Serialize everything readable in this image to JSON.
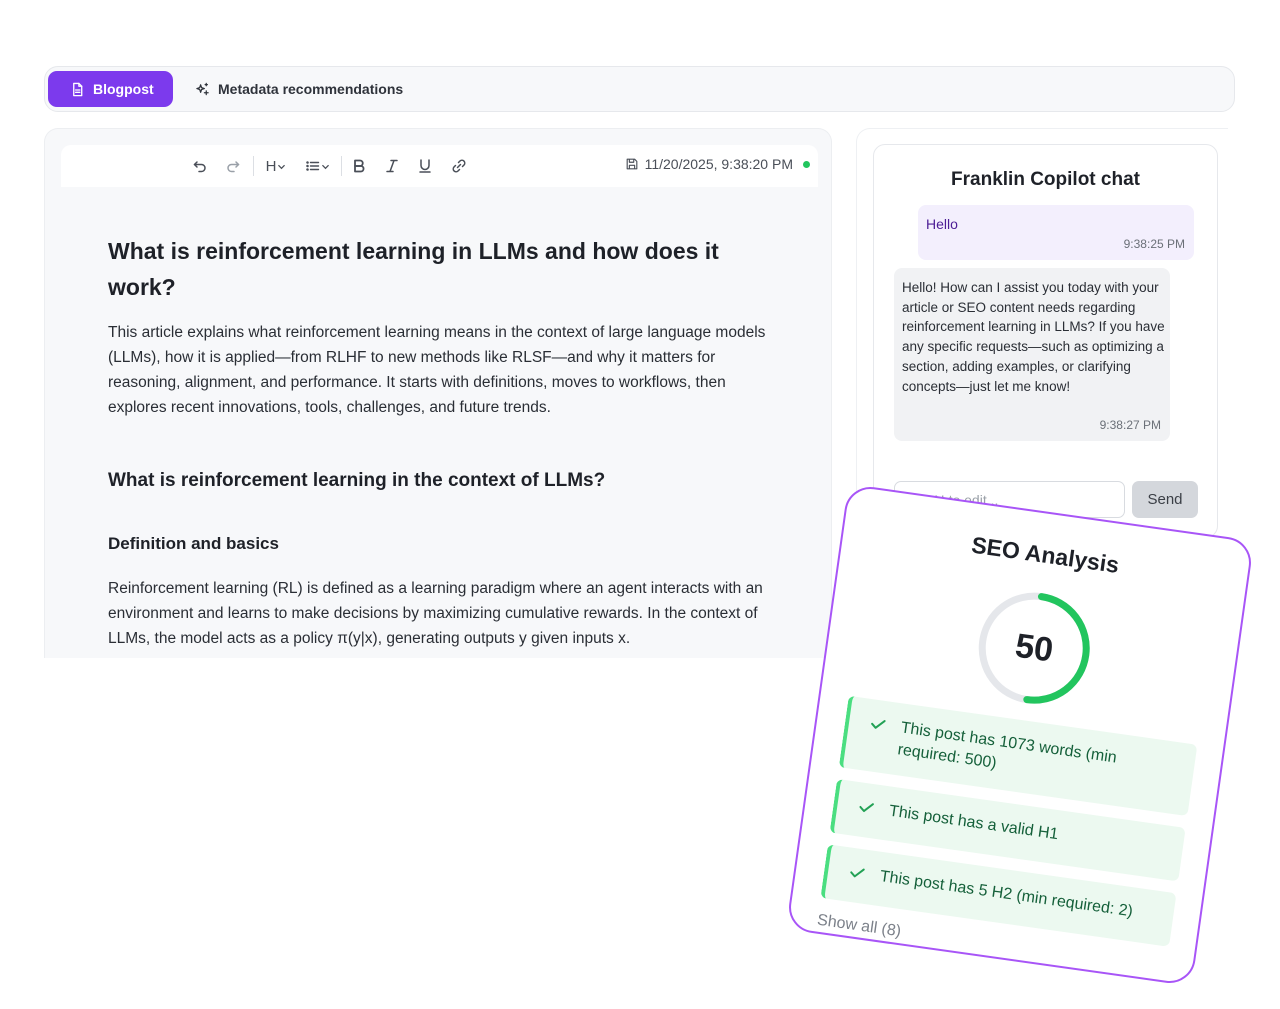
{
  "tabs": [
    {
      "label": "Blogpost",
      "icon": "document-icon",
      "active": true
    },
    {
      "label": "Metadata recommendations",
      "icon": "sparkles-icon",
      "active": false
    }
  ],
  "toolbar": {
    "heading_label": "H",
    "timestamp": "11/20/2025, 9:38:20 PM",
    "status_color": "#22c55e"
  },
  "document": {
    "title": "What is reinforcement learning in LLMs and how does it work?",
    "intro": "This article explains what reinforcement learning means in the context of large language models (LLMs), how it is applied—from RLHF to new methods like RLSF—and why it matters for reasoning, alignment, and performance. It starts with definitions, moves to workflows, then explores recent innovations, tools, challenges, and future trends.",
    "h2": "What is reinforcement learning in the context of LLMs?",
    "h3": "Definition and basics",
    "body": "Reinforcement learning (RL) is defined as a learning paradigm where an agent interacts with an environment and learns to make decisions by maximizing cumulative rewards. In the context of LLMs, the model acts as a policy π(y|x), generating outputs y given inputs x."
  },
  "chat": {
    "title": "Franklin Copilot chat",
    "messages": [
      {
        "role": "user",
        "text": "Hello",
        "time": "9:38:25 PM"
      },
      {
        "role": "assistant",
        "text": "Hello! How can I assist you today with your article or SEO content needs regarding reinforcement learning in LLMs? If you have any specific requests—such as optimizing a section, adding examples, or clarifying concepts—just let me know!",
        "time": "9:38:27 PM"
      }
    ],
    "input_placeholder": "Ask AI to edit...",
    "send_label": "Send"
  },
  "seo": {
    "title": "SEO Analysis",
    "score": "50",
    "score_fraction": 0.5,
    "checks": [
      {
        "text": "This post has 1073 words (min required: 500)",
        "status": "pass"
      },
      {
        "text": "This post has a valid H1",
        "status": "pass"
      },
      {
        "text": "This post has 5 H2 (min required: 2)",
        "status": "pass"
      }
    ],
    "show_all": "Show all (8)",
    "colors": {
      "accent": "#a855f7",
      "pass": "#22c55e",
      "brand": "#7c3aed"
    }
  }
}
